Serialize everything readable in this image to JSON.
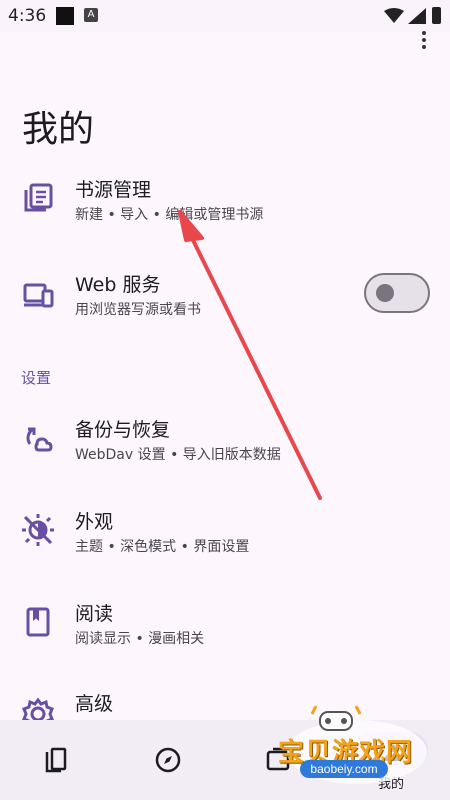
{
  "status_bar": {
    "time": "4:36",
    "notification_icon": "A"
  },
  "page": {
    "title": "我的"
  },
  "items": [
    {
      "title": "书源管理",
      "subtitle": "新建 • 导入 • 编辑或管理书源",
      "icon": "book-list-icon"
    },
    {
      "title": "Web 服务",
      "subtitle": "用浏览器写源或看书",
      "icon": "devices-icon",
      "toggle_on": false
    },
    {
      "title": "备份与恢复",
      "subtitle": "WebDav 设置 • 导入旧版本数据",
      "icon": "backup-restore-icon"
    },
    {
      "title": "外观",
      "subtitle": "主题 • 深色模式 • 界面设置",
      "icon": "theme-icon"
    },
    {
      "title": "阅读",
      "subtitle": "阅读显示 • 漫画相关",
      "icon": "bookmark-book-icon"
    },
    {
      "title": "高级",
      "subtitle": "",
      "icon": "gear-icon"
    }
  ],
  "section": {
    "settings_label": "设置"
  },
  "bottom_nav": {
    "items": [
      {
        "icon": "bookshelf-icon"
      },
      {
        "icon": "compass-icon"
      },
      {
        "icon": "rss-icon"
      },
      {
        "icon": "profile-icon",
        "label": "我的"
      }
    ]
  },
  "watermark": {
    "text": "宝贝游戏网",
    "url": "baobeiy.com"
  },
  "colors": {
    "accent": "#6750a4",
    "background": "#fdf7fd",
    "arrow": "#e8474b"
  }
}
